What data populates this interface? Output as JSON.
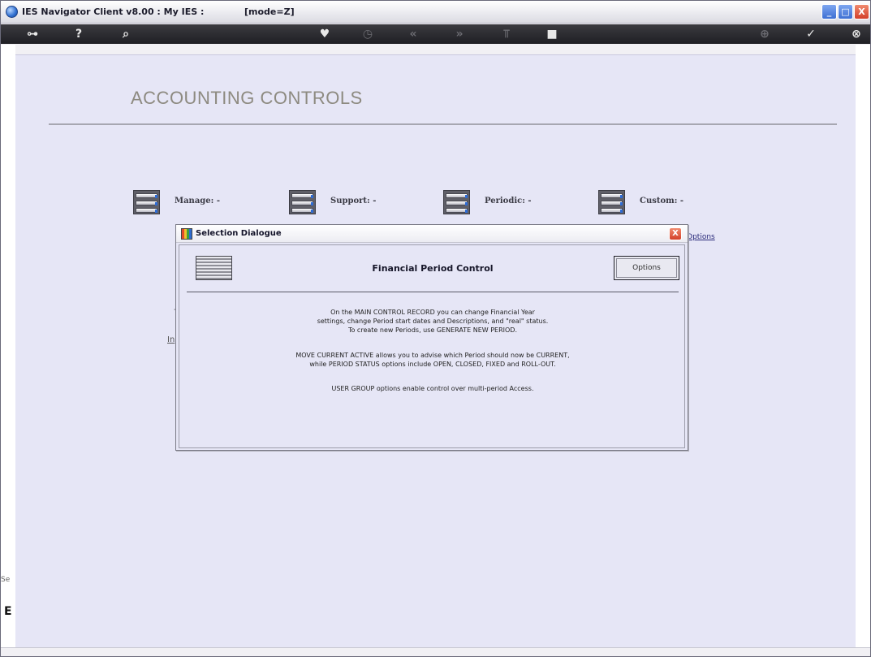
{
  "window": {
    "title": "IES Navigator Client v8.00 : My IES :",
    "mode": "[mode=Z]",
    "buttons": {
      "minimize": "_",
      "maximize": "□",
      "close": "X"
    }
  },
  "toolbar": {
    "icons": [
      "key-icon",
      "help-icon",
      "search-icon",
      "heart-icon",
      "clock-icon",
      "rewind-icon",
      "forward-icon",
      "filter-icon",
      "stop-icon",
      "add-icon",
      "check-icon",
      "exit-icon"
    ],
    "glyphs": {
      "key": "⊶",
      "help": "?",
      "search": "⌕",
      "heart": "♥",
      "clock": "◷",
      "rewind": "«",
      "forward": "»",
      "filter": "⫪",
      "stop": "■",
      "add": "⊕",
      "check": "✓",
      "exit": "⊗"
    }
  },
  "page": {
    "title": "ACCOUNTING CONTROLS"
  },
  "menu": [
    {
      "label": "Manage: -"
    },
    {
      "label": "Support: -"
    },
    {
      "label": "Periodic: -"
    },
    {
      "label": "Custom: -"
    }
  ],
  "underlay": {
    "options_link": "Options",
    "fragment_in": "In",
    "fragment_dash": "-",
    "side_text": "Se",
    "side_letter": "E"
  },
  "dialog": {
    "title": "Selection Dialogue",
    "close": "X",
    "heading": "Financial Period Control",
    "options_button": "Options",
    "paragraphs": [
      [
        "On the MAIN CONTROL RECORD you can change Financial Year",
        "settings, change Period start dates and Descriptions, and \"real\" status.",
        "To create new Periods, use GENERATE NEW PERIOD."
      ],
      [
        "MOVE CURRENT ACTIVE allows you to advise which Period should now be CURRENT,",
        "while PERIOD STATUS options include OPEN, CLOSED, FIXED and ROLL-OUT."
      ],
      [
        "USER GROUP options enable control over multi-period Access."
      ]
    ]
  }
}
